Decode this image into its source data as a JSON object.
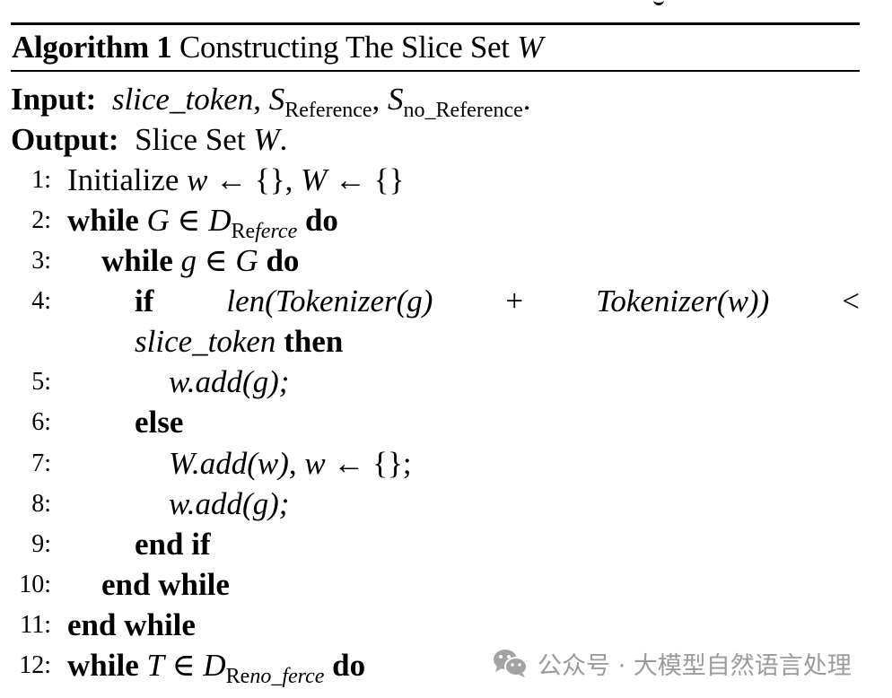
{
  "algorithm": {
    "caption_label": "Algorithm 1",
    "caption_text": "Constructing The Slice Set",
    "caption_var": "W",
    "input": {
      "label": "Input:",
      "param1": "slice_token",
      "sep1": ",",
      "param2_base": "S",
      "param2_sub": "Reference",
      "sep2": ",",
      "param3_base": "S",
      "param3_sub": "no_Reference",
      "end": "."
    },
    "output": {
      "label": "Output:",
      "text": "Slice Set",
      "var": "W",
      "end": "."
    },
    "lines": [
      {
        "num": "1:",
        "text": "Initialize"
      },
      {
        "num": "2:",
        "kw": "while",
        "var": "G",
        "op": "∈",
        "set_base": "D",
        "set_sub_upright": "Re",
        "set_sub_italic": "ferce",
        "kw2": "do"
      },
      {
        "num": "3:",
        "kw": "while",
        "var": "g",
        "op": "∈",
        "set": "G",
        "kw2": "do"
      },
      {
        "num": "4:",
        "kw": "if",
        "expr1": "len(Tokenizer(g)",
        "plus": "+",
        "expr2": "Tokenizer(w))",
        "lt": "<",
        "cont": "slice_token",
        "kw2": "then"
      },
      {
        "num": "5:",
        "stmt": "w.add(g);"
      },
      {
        "num": "6:",
        "kw": "else"
      },
      {
        "num": "7:",
        "stmt_a": "W.add(w)",
        "sep": ",",
        "stmt_b": "w",
        "arrow": "←",
        "braces": "{}",
        "end": ";"
      },
      {
        "num": "8:",
        "stmt": "w.add(g);"
      },
      {
        "num": "9:",
        "kw": "end if"
      },
      {
        "num": "10:",
        "kw": "end while"
      },
      {
        "num": "11:",
        "kw": "end while"
      },
      {
        "num": "12:",
        "kw": "while",
        "var": "T",
        "op": "∈",
        "set_base": "D",
        "set_sub_upright": "Re",
        "set_sub_italic": "no_ferce",
        "kw2": "do"
      }
    ],
    "init": {
      "var1": "w",
      "arrow": "←",
      "braces": "{}",
      "sep": ",",
      "var2": "W"
    }
  },
  "watermark": {
    "icon": "wechat-icon",
    "text": "公众号 · 大模型自然语言处理",
    "color": "#9b9b9b"
  }
}
